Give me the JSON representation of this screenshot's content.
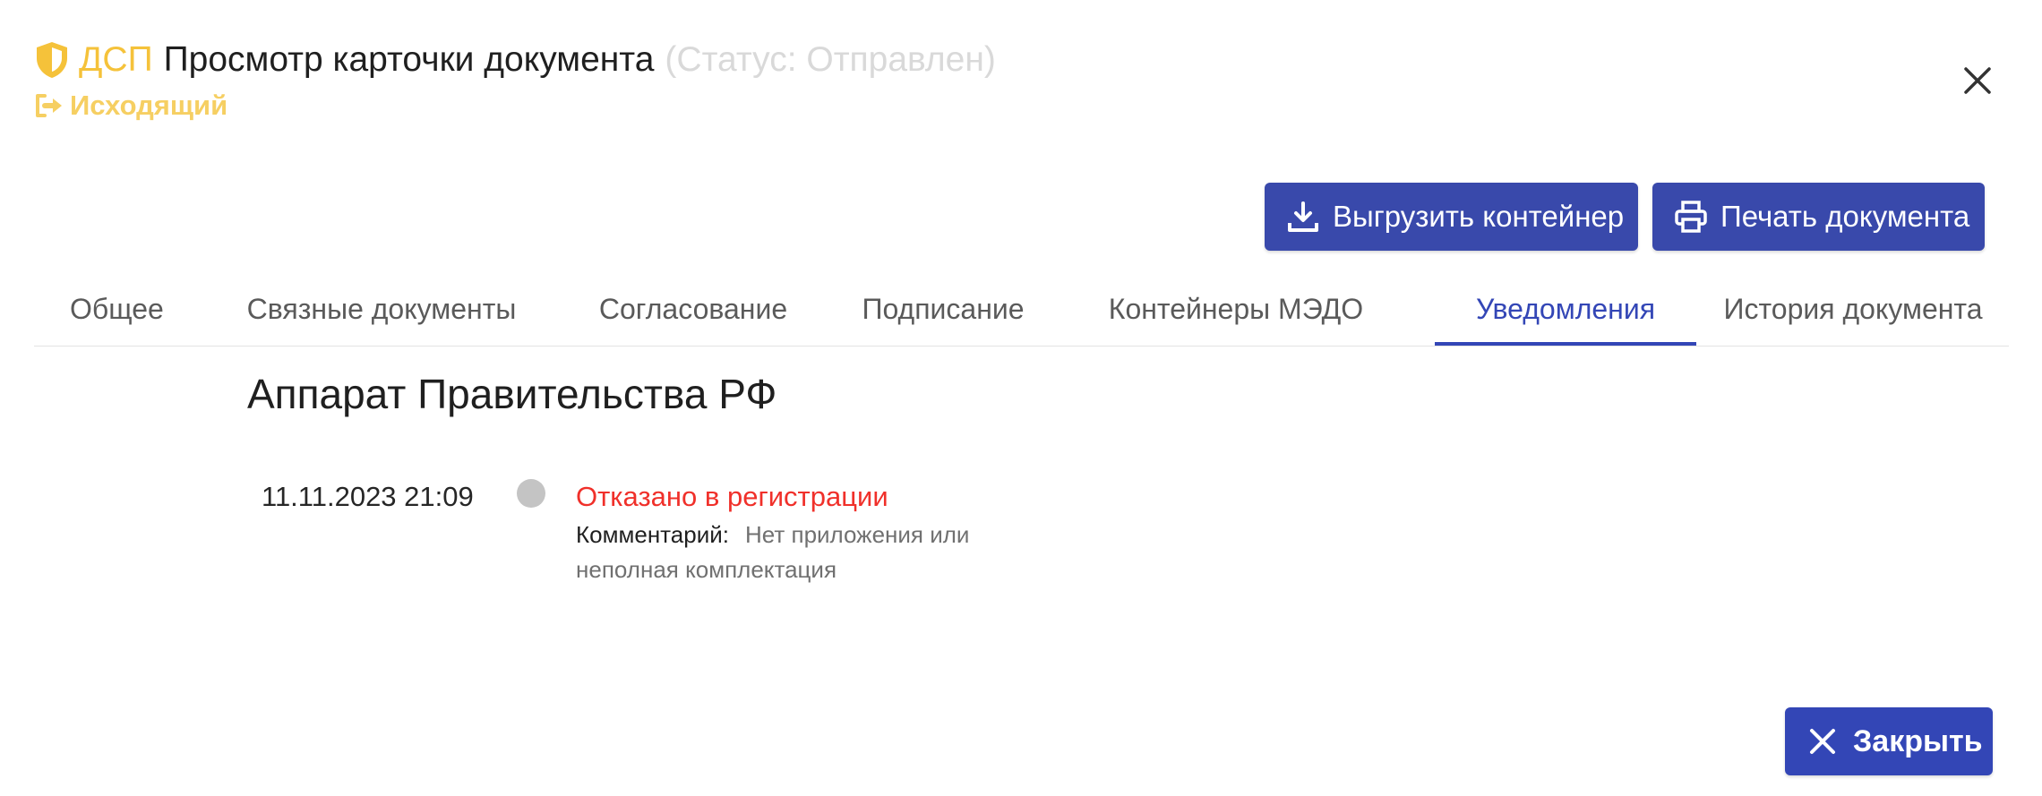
{
  "header": {
    "classification": "ДСП",
    "title": "Просмотр карточки документа",
    "status": "(Статус: Отправлен)",
    "direction": "Исходящий"
  },
  "actions": {
    "export_label": "Выгрузить контейнер",
    "print_label": "Печать документа",
    "close_label": "Закрыть"
  },
  "tabs": [
    {
      "label": "Общее"
    },
    {
      "label": "Связные документы"
    },
    {
      "label": "Согласование"
    },
    {
      "label": "Подписание"
    },
    {
      "label": "Контейнеры МЭДО"
    },
    {
      "label": "Уведомления",
      "active": true
    },
    {
      "label": "История документа"
    }
  ],
  "notifications": {
    "organization": "Аппарат Правительства РФ",
    "items": [
      {
        "datetime": "11.11.2023 21:09",
        "status": "Отказано в регистрации",
        "comment_label": "Комментарий:",
        "comment": "Нет приложения или неполная комплектация"
      }
    ]
  },
  "colors": {
    "accent": "#3346b6",
    "dsp_yellow": "#f5c23a",
    "error_red": "#f0302a",
    "dot_gray": "#c4c4c4"
  },
  "icons": {
    "classification": "shield-icon",
    "direction": "outgoing-arrow-icon",
    "export": "download-icon",
    "print": "printer-icon",
    "close": "close-icon"
  }
}
